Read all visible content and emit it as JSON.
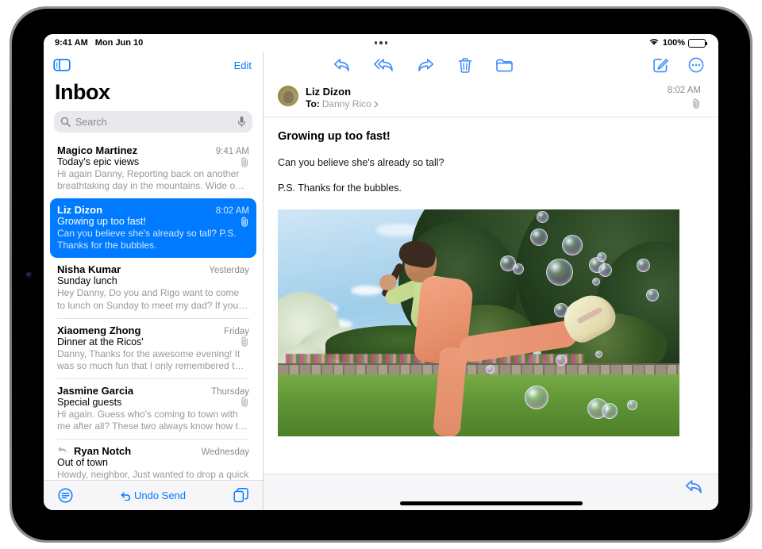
{
  "status_bar": {
    "time": "9:41 AM",
    "date": "Mon Jun 10",
    "battery_percent": "100%",
    "wifi_icon": "wifi-icon",
    "battery_icon": "battery-icon",
    "multitask_icon": "multitasking-grabber-icon"
  },
  "sidebar": {
    "toggle_icon": "sidebar-toggle-icon",
    "edit_label": "Edit",
    "title": "Inbox",
    "search": {
      "placeholder": "Search",
      "value": "",
      "search_icon": "search-icon",
      "mic_icon": "microphone-icon"
    },
    "messages": [
      {
        "sender": "Magico Martinez",
        "date": "9:41 AM",
        "subject": "Today's epic views",
        "preview": "Hi again Danny, Reporting back on another breathtaking day in the mountains. Wide o…",
        "has_attachment": true,
        "replied": false,
        "selected": false
      },
      {
        "sender": "Liz Dizon",
        "date": "8:02 AM",
        "subject": "Growing up too fast!",
        "preview": "Can you believe she's already so tall? P.S. Thanks for the bubbles.",
        "has_attachment": true,
        "replied": false,
        "selected": true
      },
      {
        "sender": "Nisha Kumar",
        "date": "Yesterday",
        "subject": "Sunday lunch",
        "preview": "Hey Danny, Do you and Rigo want to come to lunch on Sunday to meet my dad? If you…",
        "has_attachment": false,
        "replied": false,
        "selected": false
      },
      {
        "sender": "Xiaomeng Zhong",
        "date": "Friday",
        "subject": "Dinner at the Ricos'",
        "preview": "Danny, Thanks for the awesome evening! It was so much fun that I only remembered t…",
        "has_attachment": true,
        "replied": false,
        "selected": false
      },
      {
        "sender": "Jasmine Garcia",
        "date": "Thursday",
        "subject": "Special guests",
        "preview": "Hi again. Guess who's coming to town with me after all? These two always know how t…",
        "has_attachment": true,
        "replied": false,
        "selected": false
      },
      {
        "sender": "Ryan Notch",
        "date": "Wednesday",
        "subject": "Out of town",
        "preview": "Howdy, neighbor, Just wanted to drop a quick note to let you know we're leaving T…",
        "has_attachment": false,
        "replied": true,
        "selected": false
      }
    ],
    "bottom_bar": {
      "filter_icon": "filter-icon",
      "undo_send_label": "Undo Send",
      "undo_icon": "undo-arrow-icon",
      "new_window_icon": "new-window-icon"
    }
  },
  "detail": {
    "toolbar": {
      "reply_icon": "reply-icon",
      "reply_all_icon": "reply-all-icon",
      "forward_icon": "forward-icon",
      "trash_icon": "trash-icon",
      "folder_icon": "folder-icon",
      "compose_icon": "compose-icon",
      "more_icon": "more-circle-icon"
    },
    "message": {
      "avatar_icon": "avatar",
      "sender": "Liz Dizon",
      "to_label": "To:",
      "to_recipient": "Danny Rico",
      "disclosure_icon": "chevron-right-icon",
      "time": "8:02 AM",
      "attachment_icon": "paperclip-icon",
      "subject": "Growing up too fast!",
      "paragraphs": [
        "Can you believe she's already so tall?",
        "P.S. Thanks for the bubbles."
      ],
      "photo_alt": "Girl in peach overalls kicking in a sunny backyard with soap bubbles"
    },
    "footer": {
      "reply_icon": "reply-icon"
    }
  },
  "colors": {
    "accent_blue": "#007AFF",
    "selected_row": "#007AFF",
    "secondary_text": "#8b8b90",
    "preview_text": "#98989d",
    "toolbar_bg": "#f6f6f8"
  }
}
